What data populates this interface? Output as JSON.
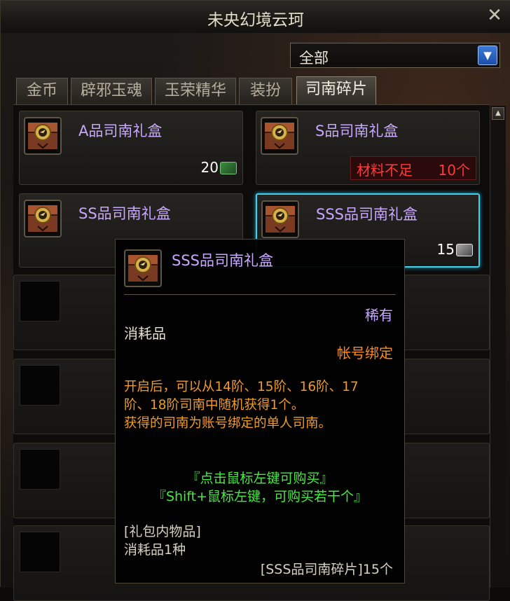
{
  "window": {
    "title": "未央幻境云珂",
    "close_glyph": "✕"
  },
  "filter": {
    "selected": "全部",
    "arrow_glyph": "▼"
  },
  "tabs": [
    {
      "label": "金币",
      "active": false
    },
    {
      "label": "辟邪玉魂",
      "active": false
    },
    {
      "label": "玉荣精华",
      "active": false
    },
    {
      "label": "装扮",
      "active": false
    },
    {
      "label": "司南碎片",
      "active": true
    }
  ],
  "items": [
    {
      "name": "A品司南礼盒",
      "count": "20",
      "ticket": "green-ticket-icon"
    },
    {
      "name": "S品司南礼盒",
      "warning": "材料不足",
      "warning_count": "10个"
    },
    {
      "name": "SS品司南礼盒"
    },
    {
      "name": "SSS品司南礼盒",
      "count": "15",
      "ticket": "silver-ticket-icon",
      "selected": true
    }
  ],
  "scroll_up_glyph": "▲",
  "tooltip": {
    "name": "SSS品司南礼盒",
    "rarity": "稀有",
    "type": "消耗品",
    "binding": "帐号绑定",
    "desc_line1": "开启后，可以从14阶、15阶、16阶、17",
    "desc_line2": "阶、18阶司南中随机获得1个。",
    "desc_line3": "获得的司南为账号绑定的单人司南。",
    "hint_click": "『点击鼠标左键可购买』",
    "hint_shift": "『Shift+鼠标左键，可购买若干个』",
    "contents_header": "[礼包内物品]",
    "contents_line": "消耗品1种",
    "piece_line": "[SSS品司南碎片]15个"
  },
  "colors": {
    "purple_text": "#c9a7ff",
    "orange_text": "#ef9b2a",
    "green_text": "#46ea42",
    "red_text": "#ff3b3b",
    "selected_border": "#3fd2ee"
  }
}
